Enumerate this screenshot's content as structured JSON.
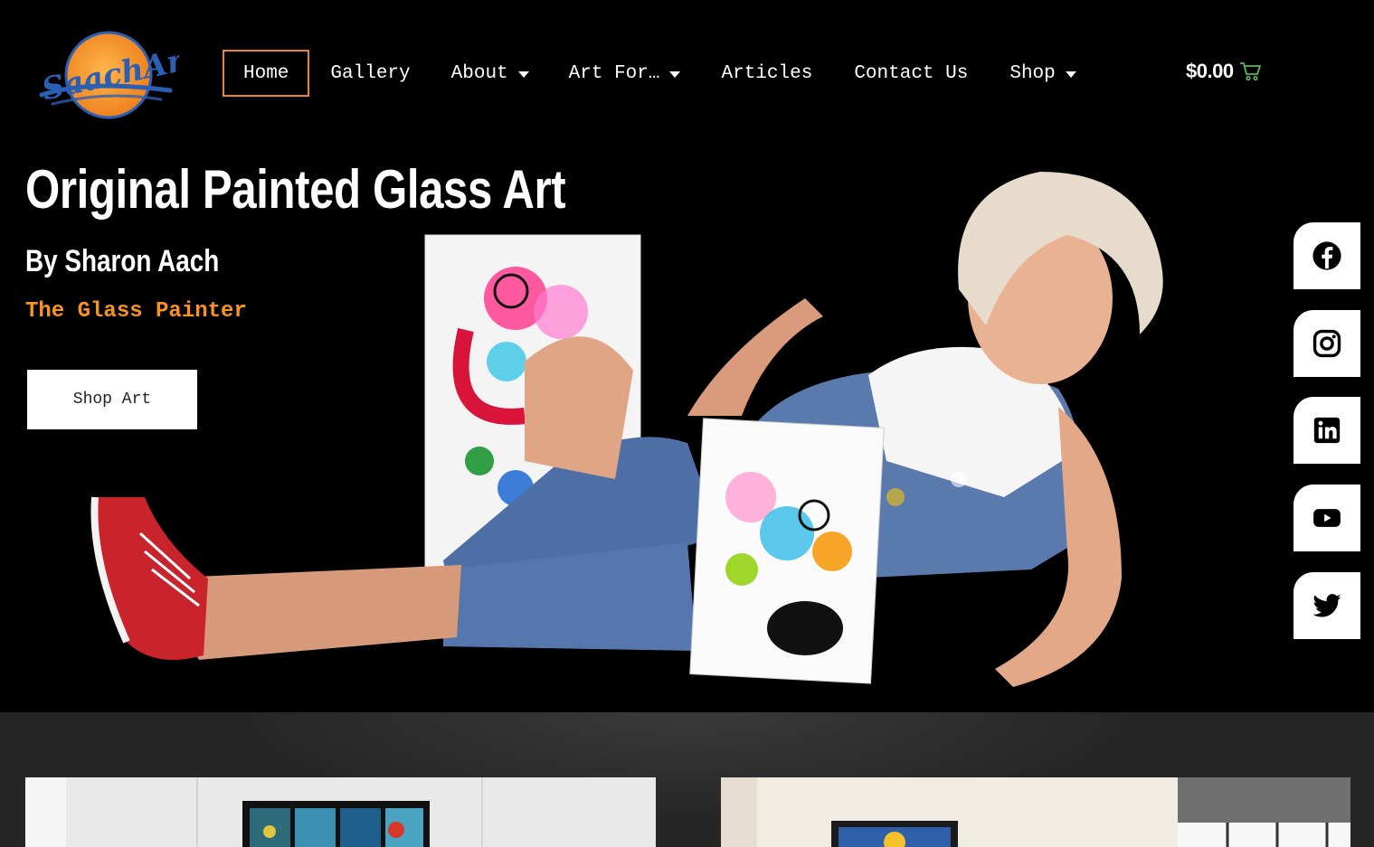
{
  "logo": {
    "text": "SaachArt"
  },
  "nav": {
    "items": [
      {
        "label": "Home",
        "active": true,
        "dropdown": false
      },
      {
        "label": "Gallery",
        "active": false,
        "dropdown": false
      },
      {
        "label": "About",
        "active": false,
        "dropdown": true
      },
      {
        "label": "Art For…",
        "active": false,
        "dropdown": true
      },
      {
        "label": "Articles",
        "active": false,
        "dropdown": false
      },
      {
        "label": "Contact Us",
        "active": false,
        "dropdown": false
      },
      {
        "label": "Shop",
        "active": false,
        "dropdown": true
      }
    ],
    "cart_total": "$0.00"
  },
  "hero": {
    "title": "Original Painted Glass Art",
    "subtitle": "By Sharon Aach",
    "tagline": "The Glass Painter",
    "cta_label": "Shop Art"
  },
  "social": [
    "facebook-icon",
    "instagram-icon",
    "linkedin-icon",
    "youtube-icon",
    "twitter-icon"
  ],
  "colors": {
    "accent_orange": "#f7931e",
    "active_border": "#e8843a",
    "cart_icon": "#5cb85c",
    "logo_blue": "#2b5fb3",
    "background": "#000000",
    "lower_bg": "#262626"
  }
}
